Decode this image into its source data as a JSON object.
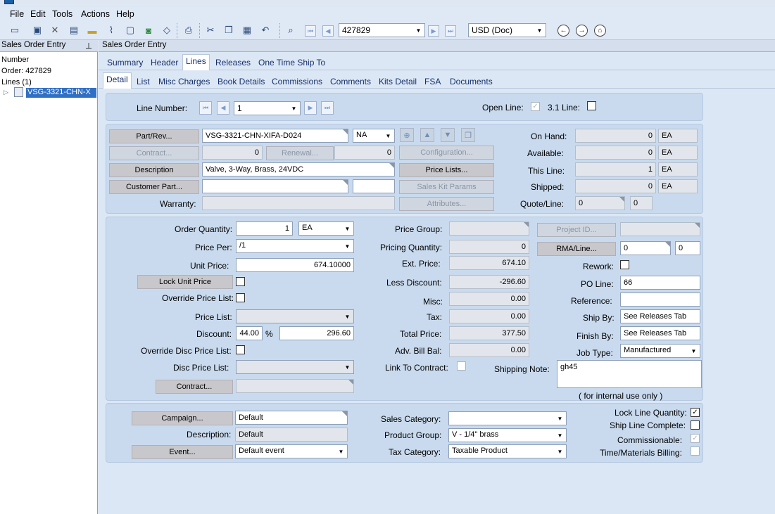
{
  "menu": {
    "file": "File",
    "edit": "Edit",
    "tools": "Tools",
    "actions": "Actions",
    "help": "Help"
  },
  "toolbar": {
    "order_number": "427829",
    "currency": "USD (Doc)"
  },
  "tree": {
    "title": "Sales Order Entry",
    "number": "Number",
    "order": "Order: 427829",
    "lines": "Lines (1)",
    "selected": "VSG-3321-CHN-X"
  },
  "main_title": "Sales Order Entry",
  "tabs": {
    "summary": "Summary",
    "header": "Header",
    "lines": "Lines",
    "releases": "Releases",
    "one_time": "One Time Ship To"
  },
  "subtabs": {
    "detail": "Detail",
    "list": "List",
    "misc": "Misc Charges",
    "book": "Book Details",
    "commissions": "Commissions",
    "comments": "Comments",
    "kits": "Kits Detail",
    "fsa": "FSA",
    "documents": "Documents"
  },
  "line_nav": {
    "label": "Line Number:",
    "value": "1",
    "open_line": "Open Line:",
    "open_line_checked": true,
    "v31": "3.1 Line:",
    "v31_checked": false
  },
  "part": {
    "part_btn": "Part/Rev...",
    "part_value": "VSG-3321-CHN-XIFA-D024",
    "rev": "NA",
    "contract_btn": "Contract...",
    "contract_value": "0",
    "renewal_btn": "Renewal...",
    "renewal_value": "0",
    "description_btn": "Description",
    "description_value": "Valve, 3-Way, Brass, 24VDC",
    "customer_part_btn": "Customer Part...",
    "warranty_label": "Warranty:",
    "configuration_btn": "Configuration...",
    "price_lists_btn": "Price Lists...",
    "kit_params_btn": "Sales Kit Params",
    "attributes_btn": "Attributes..."
  },
  "stock": {
    "on_hand_label": "On Hand:",
    "on_hand": "0",
    "available_label": "Available:",
    "available": "0",
    "this_line_label": "This Line:",
    "this_line": "1",
    "shipped_label": "Shipped:",
    "shipped": "0",
    "uom": "EA",
    "quote_line_label": "Quote/Line:",
    "quote": "0",
    "quote_line": "0"
  },
  "pricing": {
    "order_qty_label": "Order Quantity:",
    "order_qty": "1",
    "order_uom": "EA",
    "price_per_label": "Price Per:",
    "price_per": "/1",
    "unit_price_label": "Unit Price:",
    "unit_price": "674.10000",
    "lock_unit_price_btn": "Lock Unit Price",
    "override_price_list": "Override Price List:",
    "price_list_label": "Price List:",
    "discount_label": "Discount:",
    "discount_pct": "44.00",
    "pct_sign": "%",
    "discount_amt": "296.60",
    "override_disc": "Override Disc Price List:",
    "disc_price_list_label": "Disc Price List:",
    "contract_btn": "Contract...",
    "price_group_label": "Price Group:",
    "pricing_qty_label": "Pricing Quantity:",
    "pricing_qty": "0",
    "ext_price_label": "Ext. Price:",
    "ext_price": "674.10",
    "less_discount_label": "Less Discount:",
    "less_discount": "-296.60",
    "misc_label": "Misc:",
    "misc": "0.00",
    "tax_label": "Tax:",
    "tax": "0.00",
    "total_label": "Total Price:",
    "total": "377.50",
    "adv_bill_label": "Adv. Bill Bal:",
    "adv_bill": "0.00",
    "link_contract": "Link To Contract:",
    "project_btn": "Project ID...",
    "rma_btn": "RMA/Line...",
    "rma": "0",
    "rma_line": "0",
    "rework_label": "Rework:",
    "po_line_label": "PO Line:",
    "po_line": "66",
    "reference_label": "Reference:",
    "ship_by_label": "Ship By:",
    "ship_by": "See Releases Tab",
    "finish_by_label": "Finish By:",
    "finish_by": "See Releases Tab",
    "job_type_label": "Job Type:",
    "job_type": "Manufactured",
    "shipping_note_label": "Shipping Note:",
    "shipping_note": "gh45",
    "internal_note": "( for internal use only )"
  },
  "bottom": {
    "campaign_btn": "Campaign...",
    "campaign": "Default",
    "description_label": "Description:",
    "description": "Default",
    "event_btn": "Event...",
    "event": "Default event",
    "sales_cat_label": "Sales Category:",
    "product_group_label": "Product Group:",
    "product_group": "V - 1/4\" brass",
    "tax_cat_label": "Tax Category:",
    "tax_cat": "Taxable Product",
    "lock_line_qty": "Lock Line Quantity:",
    "ship_line_complete": "Ship Line Complete:",
    "commissionable": "Commissionable:",
    "tm_billing": "Time/Materials Billing:"
  }
}
